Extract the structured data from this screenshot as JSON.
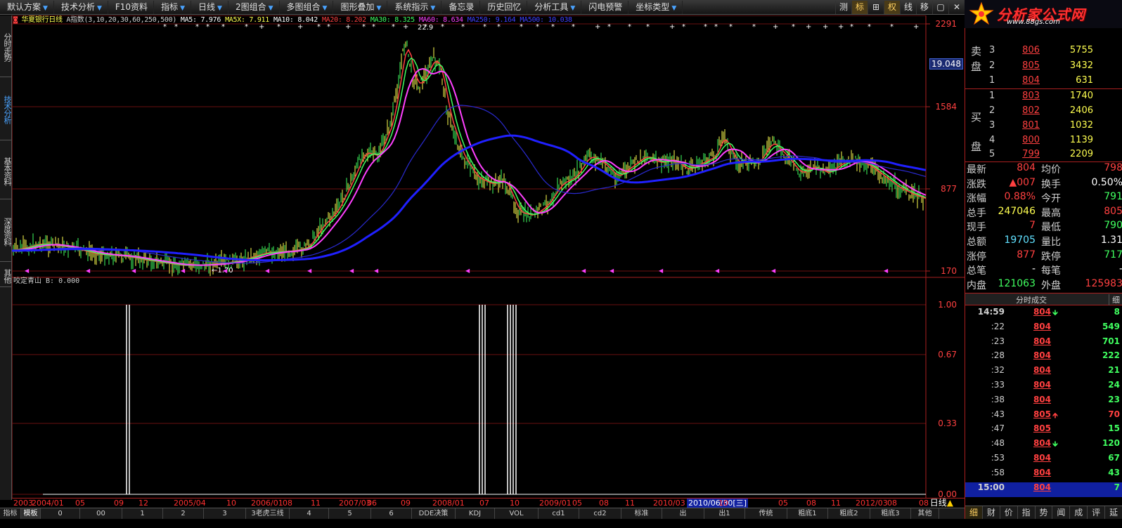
{
  "menu": [
    {
      "label": "默认方案",
      "arrow": "▼"
    },
    {
      "label": "技术分析",
      "arrow": "▼"
    },
    {
      "label": "F10资料",
      "arrow": ""
    },
    {
      "label": "指标",
      "arrow": "▼"
    },
    {
      "label": "日线",
      "arrow": "▼"
    },
    {
      "label": "2图组合",
      "arrow": "▼"
    },
    {
      "label": "多图组合",
      "arrow": "▼"
    },
    {
      "label": "图形叠加",
      "arrow": "▼"
    },
    {
      "label": "系统指示",
      "arrow": "▼"
    },
    {
      "label": "备忘录",
      "arrow": ""
    },
    {
      "label": "历史回忆",
      "arrow": ""
    },
    {
      "label": "分析工具",
      "arrow": "▼"
    },
    {
      "label": "闪电预警",
      "arrow": ""
    },
    {
      "label": "坐标类型",
      "arrow": "▼"
    }
  ],
  "toolbar": [
    "测",
    "标",
    "⊞",
    "权",
    "线",
    "移",
    "▢",
    "✕"
  ],
  "logo": {
    "name": "分析家公式网",
    "url": "www.88gs.com"
  },
  "left_tabs": [
    "分时走势",
    "技术分析",
    "基本资料",
    "深度资料",
    "其他"
  ],
  "chart": {
    "stock_name": "华夏银行日线",
    "indicator_params": "A指数(3,10,20,30,60,250,500)",
    "ma": [
      {
        "label": "MA5: 7.976",
        "color": "#ffffff"
      },
      {
        "label": "MA5X: 7.911",
        "color": "#ffff50"
      },
      {
        "label": "MA10: 8.042",
        "color": "#ffffff"
      },
      {
        "label": "MA20: 8.202",
        "color": "#ff4040"
      },
      {
        "label": "MA30: 8.325",
        "color": "#40ff60"
      },
      {
        "label": "MA60: 8.634",
        "color": "#ff40ff"
      },
      {
        "label": "MA250: 9.164",
        "color": "#4040ff"
      },
      {
        "label": "MA500: 10.038",
        "color": "#4040ff"
      }
    ],
    "price_axis": [
      "2291",
      "1584",
      "877",
      "170"
    ],
    "current_price_box": "19.048",
    "peak_label": "22.9",
    "low_label": "1.70",
    "sub_indicator": "咬定青山 B: 0.000",
    "sub_axis": [
      "1.00",
      "0.67",
      "0.33",
      "0.00"
    ],
    "dates": [
      "2003",
      "2004/01",
      "05",
      "09",
      "12",
      "2005/04",
      "10",
      "2006/01",
      "08",
      "11",
      "2007/03",
      "06",
      "09",
      "2008/01",
      "07",
      "10",
      "2009/01",
      "05",
      "08",
      "11",
      "2010/03",
      "10",
      "05",
      "08",
      "11",
      "2012/03",
      "08",
      "08"
    ],
    "date_highlight": "2010/06/30[三]",
    "period": "日线"
  },
  "bottom_tabs": [
    "指标",
    "模板",
    "0",
    "00",
    "1",
    "2",
    "3",
    "3老虎三线",
    "4",
    "5",
    "6",
    "DDE决策",
    "KDJ",
    "VOL",
    "cd1",
    "cd2",
    "标准",
    "出",
    "出1",
    "传统",
    "粗底1",
    "粗底2",
    "粗底3",
    "其他"
  ],
  "orderbook": {
    "sell": [
      {
        "side": "卖",
        "level": "3",
        "price": "806",
        "vol": "5755"
      },
      {
        "side": "盘",
        "level": "2",
        "price": "805",
        "vol": "3432"
      },
      {
        "side": "",
        "level": "1",
        "price": "804",
        "vol": "631"
      }
    ],
    "buy": [
      {
        "side": "",
        "level": "1",
        "price": "803",
        "vol": "1740"
      },
      {
        "side": "买",
        "level": "2",
        "price": "802",
        "vol": "2406"
      },
      {
        "side": "",
        "level": "3",
        "price": "801",
        "vol": "1032"
      },
      {
        "side": "盘",
        "level": "4",
        "price": "800",
        "vol": "1139"
      },
      {
        "side": "",
        "level": "5",
        "price": "799",
        "vol": "2209"
      }
    ]
  },
  "quote": [
    {
      "l1": "最新",
      "v1": "804",
      "c1": "red",
      "l2": "均价",
      "v2": "798",
      "c2": "red"
    },
    {
      "l1": "涨跌",
      "v1": "▲007",
      "c1": "red",
      "l2": "换手",
      "v2": "0.50%",
      "c2": "white"
    },
    {
      "l1": "涨幅",
      "v1": "0.88%",
      "c1": "red",
      "l2": "今开",
      "v2": "791",
      "c2": "green"
    },
    {
      "l1": "总手",
      "v1": "247046",
      "c1": "yellow",
      "l2": "最高",
      "v2": "805",
      "c2": "red"
    },
    {
      "l1": "现手",
      "v1": "7",
      "c1": "red",
      "l2": "最低",
      "v2": "790",
      "c2": "green"
    },
    {
      "l1": "总额",
      "v1": "19705",
      "c1": "cyan",
      "l2": "量比",
      "v2": "1.31",
      "c2": "white"
    },
    {
      "l1": "涨停",
      "v1": "877",
      "c1": "red",
      "l2": "跌停",
      "v2": "717",
      "c2": "green"
    },
    {
      "l1": "总笔",
      "v1": "-",
      "c1": "white",
      "l2": "每笔",
      "v2": "-",
      "c2": "white"
    },
    {
      "l1": "内盘",
      "v1": "121063",
      "c1": "green",
      "l2": "外盘",
      "v2": "125983",
      "c2": "red"
    }
  ],
  "ticks": {
    "title": "分时成交",
    "button": "细",
    "rows": [
      {
        "time": "14:59",
        "price": "804",
        "dir": "down",
        "vol": "8",
        "vc": "green"
      },
      {
        "time": ":22",
        "price": "804",
        "dir": "",
        "vol": "549",
        "vc": "green"
      },
      {
        "time": ":23",
        "price": "804",
        "dir": "",
        "vol": "701",
        "vc": "green"
      },
      {
        "time": ":28",
        "price": "804",
        "dir": "",
        "vol": "222",
        "vc": "green"
      },
      {
        "time": ":32",
        "price": "804",
        "dir": "",
        "vol": "21",
        "vc": "green"
      },
      {
        "time": ":33",
        "price": "804",
        "dir": "",
        "vol": "24",
        "vc": "green"
      },
      {
        "time": ":38",
        "price": "804",
        "dir": "",
        "vol": "23",
        "vc": "green"
      },
      {
        "time": ":43",
        "price": "805",
        "dir": "up",
        "vol": "70",
        "vc": "red"
      },
      {
        "time": ":47",
        "price": "805",
        "dir": "",
        "vol": "15",
        "vc": "green"
      },
      {
        "time": ":48",
        "price": "804",
        "dir": "down",
        "vol": "120",
        "vc": "green"
      },
      {
        "time": ":53",
        "price": "804",
        "dir": "",
        "vol": "67",
        "vc": "green"
      },
      {
        "time": ":58",
        "price": "804",
        "dir": "",
        "vol": "43",
        "vc": "green"
      },
      {
        "time": "15:00",
        "price": "804",
        "dir": "",
        "vol": "7",
        "vc": "green"
      }
    ]
  },
  "panel_tabs": [
    "细",
    "财",
    "价",
    "指",
    "势",
    "闻",
    "成",
    "评",
    "延"
  ]
}
